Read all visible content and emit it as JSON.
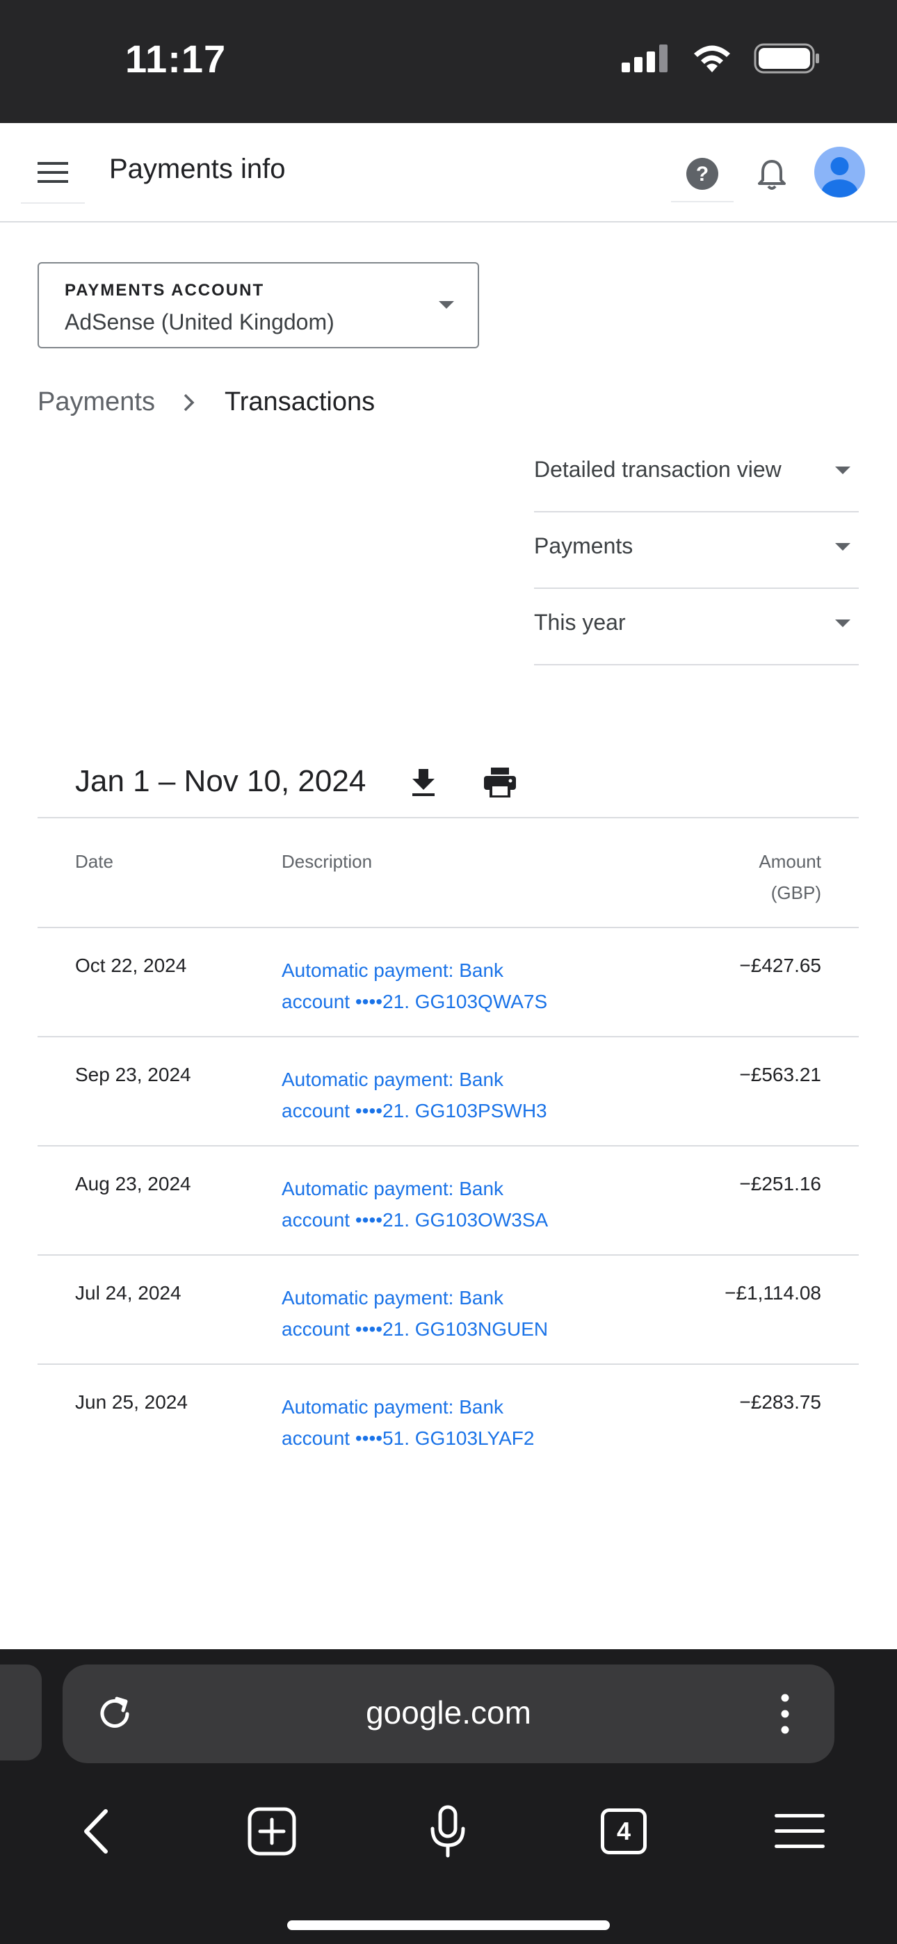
{
  "status_bar": {
    "time": "11:17",
    "icons": [
      "cellular-signal-icon",
      "wifi-icon",
      "battery-icon"
    ]
  },
  "header": {
    "title": "Payments info",
    "icons": [
      "menu-icon",
      "help-icon",
      "notifications-bell-icon",
      "account-avatar-icon"
    ]
  },
  "account": {
    "label": "PAYMENTS ACCOUNT",
    "value": "AdSense (United Kingdom)"
  },
  "breadcrumb": {
    "parent": "Payments",
    "separator": "›",
    "current": "Transactions"
  },
  "filters": [
    {
      "label": "Detailed transaction view"
    },
    {
      "label": "Payments"
    },
    {
      "label": "This year"
    }
  ],
  "range": {
    "text": "Jan 1 – Nov 10, 2024",
    "icons": [
      "download-icon",
      "print-icon"
    ]
  },
  "table": {
    "headers": {
      "date": "Date",
      "description": "Description",
      "amount_line1": "Amount",
      "amount_line2": "(GBP)"
    },
    "rows": [
      {
        "date": "Oct 22, 2024",
        "description_line1": "Automatic payment: Bank",
        "description_line2": "account  ••••21. GG103QWA7S",
        "amount": "−£427.65"
      },
      {
        "date": "Sep 23, 2024",
        "description_line1": "Automatic payment: Bank",
        "description_line2": "account  ••••21. GG103PSWH3",
        "amount": "−£563.21"
      },
      {
        "date": "Aug 23, 2024",
        "description_line1": "Automatic payment: Bank",
        "description_line2": "account  ••••21. GG103OW3SA",
        "amount": "−£251.16"
      },
      {
        "date": "Jul 24, 2024",
        "description_line1": "Automatic payment: Bank",
        "description_line2": "account  ••••21. GG103NGUEN",
        "amount": "−£1,114.08"
      },
      {
        "date": "Jun 25, 2024",
        "description_line1": "Automatic payment: Bank",
        "description_line2": "account  ••••51. GG103LYAF2",
        "amount": "−£283.75"
      }
    ]
  },
  "browser": {
    "url": "google.com",
    "tab_count": "4",
    "icons": [
      "reload-icon",
      "more-vertical-icon",
      "back-icon",
      "new-tab-icon",
      "microphone-icon",
      "tabs-icon",
      "menu-icon"
    ]
  },
  "colors": {
    "link": "#1a73e8",
    "avatar": "#8ab4f8",
    "divider": "#dadce0",
    "browser_bg": "#1c1c1e"
  }
}
